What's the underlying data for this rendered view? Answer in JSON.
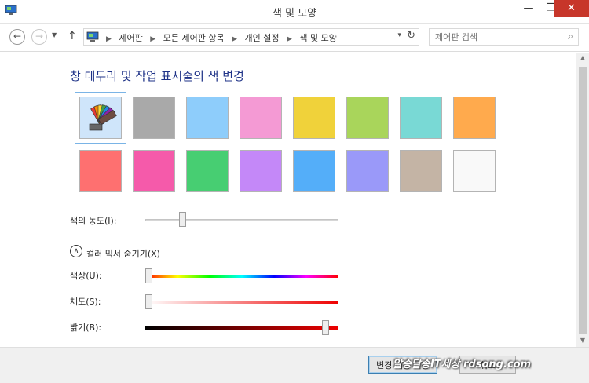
{
  "window": {
    "title": "색 및 모양",
    "min_icon": "minimize-icon",
    "max_icon": "maximize-icon",
    "close_icon": "close-icon",
    "min_glyph": "—",
    "max_glyph": "❐",
    "close_glyph": "✕"
  },
  "nav": {
    "back_glyph": "←",
    "forward_glyph": "→",
    "recent_glyph": "▼",
    "up_glyph": "↑",
    "breadcrumbs": [
      "제어판",
      "모든 제어판 항목",
      "개인 설정",
      "색 및 모양"
    ],
    "separator": "▶",
    "dropdown_glyph": "▾",
    "refresh_glyph": "↻",
    "search_placeholder": "제어판 검색",
    "search_glyph": "⌕"
  },
  "main": {
    "heading": "창 테두리 및 작업 표시줄의 색 변경",
    "swatches": [
      {
        "color": "#cfe5fa",
        "name": "automatic",
        "selected": true
      },
      {
        "color": "#a9a9a9",
        "name": "gray"
      },
      {
        "color": "#8ecdfb",
        "name": "sky-blue"
      },
      {
        "color": "#f49ad4",
        "name": "pink"
      },
      {
        "color": "#f0d23a",
        "name": "yellow"
      },
      {
        "color": "#a9d55b",
        "name": "lime"
      },
      {
        "color": "#79d9d5",
        "name": "teal"
      },
      {
        "color": "#ffaa4d",
        "name": "orange"
      },
      {
        "color": "#fe7070",
        "name": "red"
      },
      {
        "color": "#f55aaa",
        "name": "magenta"
      },
      {
        "color": "#47ce72",
        "name": "green"
      },
      {
        "color": "#c488f8",
        "name": "violet"
      },
      {
        "color": "#54aef9",
        "name": "blue"
      },
      {
        "color": "#9a99f9",
        "name": "periwinkle"
      },
      {
        "color": "#c4b4a5",
        "name": "taupe"
      },
      {
        "color": "#f9f9f9",
        "name": "white"
      }
    ],
    "intensity": {
      "label": "색의 농도(I):",
      "value": 0.18
    },
    "mixer": {
      "toggle_glyph": "∧",
      "label": "컬러 믹서 숨기기(X)",
      "hue": {
        "label": "색상(U):",
        "value": 0.0
      },
      "saturation": {
        "label": "채도(S):",
        "value": 0.0
      },
      "brightness": {
        "label": "밝기(B):",
        "value": 0.95
      }
    }
  },
  "footer": {
    "save_label": "변경 내용 저장",
    "cancel_label": "취소",
    "watermark": "알송달송IT세상 rdsong.com"
  }
}
